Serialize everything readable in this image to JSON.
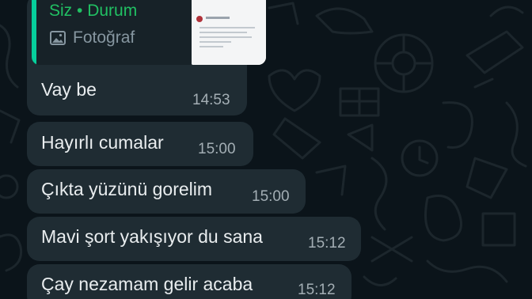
{
  "reply": {
    "author": "Siz • Durum",
    "media_type": "Fotoğraf",
    "media_icon": "photo-icon"
  },
  "messages": [
    {
      "text": "Vay be",
      "time": "14:53"
    },
    {
      "text": "Hayırlı cumalar",
      "time": "15:00"
    },
    {
      "text": "Çıkta yüzünü gorelim",
      "time": "15:00"
    },
    {
      "text": "Mavi şort yakışıyor du sana",
      "time": "15:12"
    },
    {
      "text": "Çay nezamam gelir acaba",
      "time": "15:12"
    }
  ],
  "colors": {
    "background": "#0b141a",
    "bubble": "#1f2c33",
    "accent_bar": "#06cf9c",
    "author": "#21c063",
    "timestamp": "#a3aeb4"
  }
}
